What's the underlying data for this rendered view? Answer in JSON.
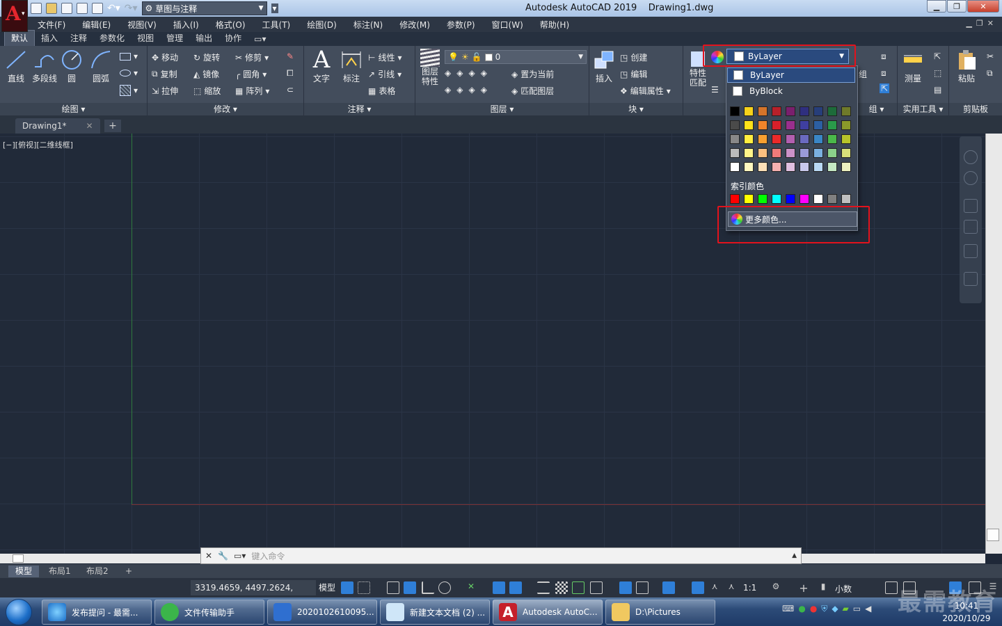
{
  "window": {
    "title": "Autodesk AutoCAD 2019    Drawing1.dwg",
    "workspace": "草图与注释",
    "logo_letter": "A"
  },
  "menu": [
    "文件(F)",
    "编辑(E)",
    "视图(V)",
    "插入(I)",
    "格式(O)",
    "工具(T)",
    "绘图(D)",
    "标注(N)",
    "修改(M)",
    "参数(P)",
    "窗口(W)",
    "帮助(H)"
  ],
  "ribbon_tabs": [
    "默认",
    "插入",
    "注释",
    "参数化",
    "视图",
    "管理",
    "输出",
    "协作"
  ],
  "ribbon": {
    "draw": {
      "title": "绘图",
      "line": "直线",
      "polyline": "多段线",
      "circle": "圆",
      "arc": "圆弧"
    },
    "modify": {
      "title": "修改",
      "move": "移动",
      "rotate": "旋转",
      "trim": "修剪",
      "copy": "复制",
      "mirror": "镜像",
      "fillet": "圆角",
      "stretch": "拉伸",
      "scale": "缩放",
      "array": "阵列"
    },
    "annotation": {
      "title": "注释",
      "text": "文字",
      "dimension": "标注",
      "linear": "线性",
      "leader": "引线",
      "table": "表格"
    },
    "layers": {
      "title": "图层",
      "properties": "图层\n特性",
      "layer_name": "0",
      "set_current": "置为当前",
      "match_layer": "匹配图层"
    },
    "block": {
      "title": "块",
      "insert": "插入",
      "create": "创建",
      "edit": "编辑",
      "edit_attributes": "编辑属性"
    },
    "properties": {
      "match": "特性\n匹配"
    },
    "groups": {
      "title": "组",
      "group": "组"
    },
    "utilities": {
      "title": "实用工具",
      "measure": "测量"
    },
    "clipboard": {
      "title": "剪贴板",
      "paste": "粘贴"
    }
  },
  "color_dropdown": {
    "current": "ByLayer",
    "options": [
      "ByLayer",
      "ByBlock"
    ],
    "index_label": "索引颜色",
    "more_colors": "更多颜色...",
    "standard_colors": [
      "#000000",
      "#f7d21a",
      "#d5742a",
      "#b8202a",
      "#7a1f6d",
      "#2f2f7f",
      "#273e7a",
      "#1d6b3a",
      "#6f7a2a",
      "#4a4a4a",
      "#ffe21a",
      "#f0842a",
      "#d8202a",
      "#9a2f8d",
      "#3f3fa0",
      "#2c5fa3",
      "#2a9a4a",
      "#8a9a2a",
      "#888888",
      "#ffee40",
      "#f9a030",
      "#ec2a2a",
      "#b25fb0",
      "#6a6ac0",
      "#3a86c6",
      "#4ab84a",
      "#b8c42a",
      "#bbbbbb",
      "#fff48a",
      "#fcc080",
      "#f07a7a",
      "#cc92c8",
      "#9a9ad8",
      "#7ab0e0",
      "#8ad08a",
      "#d8e07a",
      "#ffffff",
      "#fff8c0",
      "#fde0b8",
      "#f5b0b0",
      "#e0c0e0",
      "#c8c8ec",
      "#b8d8f4",
      "#c4e8c4",
      "#ecf0c0"
    ],
    "index_colors": [
      "#ff0000",
      "#ffff00",
      "#00ff00",
      "#00ffff",
      "#0000ff",
      "#ff00ff",
      "#ffffff",
      "#808080",
      "#c0c0c0"
    ]
  },
  "document_tabs": [
    "Drawing1*"
  ],
  "viewport_label": "[−][俯视][二维线框]",
  "command_placeholder": "键入命令",
  "layout_tabs": [
    "模型",
    "布局1",
    "布局2"
  ],
  "status": {
    "coords": "3319.4659, 4497.2624, 0.0000",
    "model": "模型",
    "scale": "1:1",
    "units": "小数"
  },
  "taskbar": {
    "items": [
      "发布提问 - 最需...",
      "文件传输助手",
      "2020102610095...",
      "新建文本文档 (2) ...",
      "Autodesk AutoC...",
      "D:\\Pictures"
    ],
    "time": "10:41",
    "date": "2020/10/29"
  },
  "watermark": "最需教育"
}
